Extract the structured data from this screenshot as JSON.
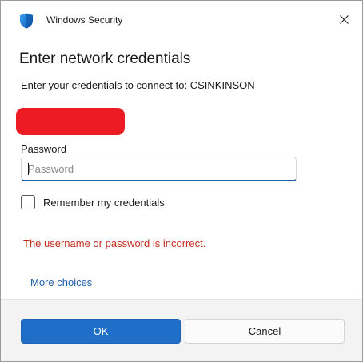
{
  "window": {
    "title": "Windows Security",
    "icon": "shield-icon",
    "close_icon": "close-icon"
  },
  "dialog": {
    "heading": "Enter network credentials",
    "subtext": "Enter your credentials to connect to: CSINKINSON",
    "password_label": "Password",
    "password_placeholder": "Password",
    "password_value": "",
    "remember_label": "Remember my credentials",
    "remember_checked": false,
    "error_message": "The username or password is incorrect.",
    "more_choices": "More choices"
  },
  "buttons": {
    "ok": "OK",
    "cancel": "Cancel"
  },
  "colors": {
    "accent": "#1f6fc9",
    "error": "#c42b1c",
    "redaction": "#ed1c24",
    "link": "#1b5fa8"
  }
}
